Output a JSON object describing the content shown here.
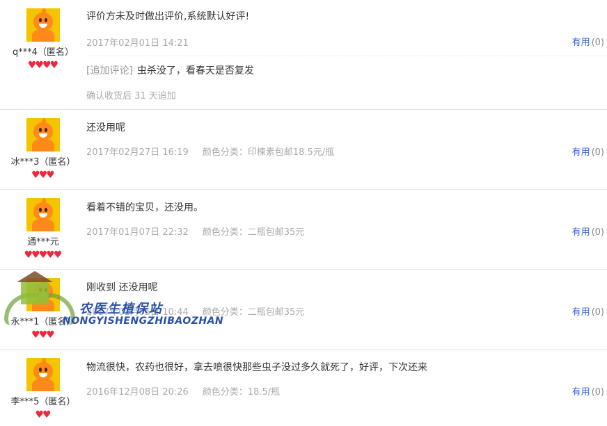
{
  "reviews": [
    {
      "user": "q***4（匿名）",
      "hearts": 4,
      "content": "评价方未及时做出评价,系统默认好评!",
      "date": "2017年02月01日 14:21",
      "sku": "",
      "useful_label": "有用",
      "useful_count": "(0)",
      "append_tag": "[追加评论]",
      "append_text": "虫杀没了，看春天是否复发",
      "append_info": "确认收货后 31 天追加"
    },
    {
      "user": "冰***3（匿名）",
      "hearts": 3,
      "content": "还没用呢",
      "date": "2017年02月27日 16:19",
      "sku": "颜色分类：印楝素包邮18.5元/瓶",
      "useful_label": "有用",
      "useful_count": "(0)"
    },
    {
      "user": "通***元",
      "hearts": 5,
      "content": "看着不错的宝贝，还没用。",
      "date": "2017年01月07日 22:32",
      "sku": "颜色分类：二瓶包邮35元",
      "useful_label": "有用",
      "useful_count": "(0)"
    },
    {
      "user": "永***1（匿名）",
      "hearts": 3,
      "content": "刚收到 还没用呢",
      "date": "2017年01月05日 10:44",
      "sku": "颜色分类：二瓶包邮35元",
      "useful_label": "有用",
      "useful_count": "(0)"
    },
    {
      "user": "李***5（匿名）",
      "hearts": 2,
      "content": "物流很快，农药也很好，拿去喷很快那些虫子没过多久就死了，好评，下次还来",
      "date": "2016年12月08日 20:26",
      "sku": "颜色分类：18.5/瓶",
      "useful_label": "有用",
      "useful_count": "(0)"
    }
  ],
  "watermark": {
    "cn": "农医生植保站",
    "en": "NONGYISHENGZHIBAOZHAN"
  },
  "colors": {
    "heart": "#e8293e",
    "link": "#3366cc",
    "avatar_bg": "#f5c400",
    "avatar_figure": "#ff8a1a"
  }
}
